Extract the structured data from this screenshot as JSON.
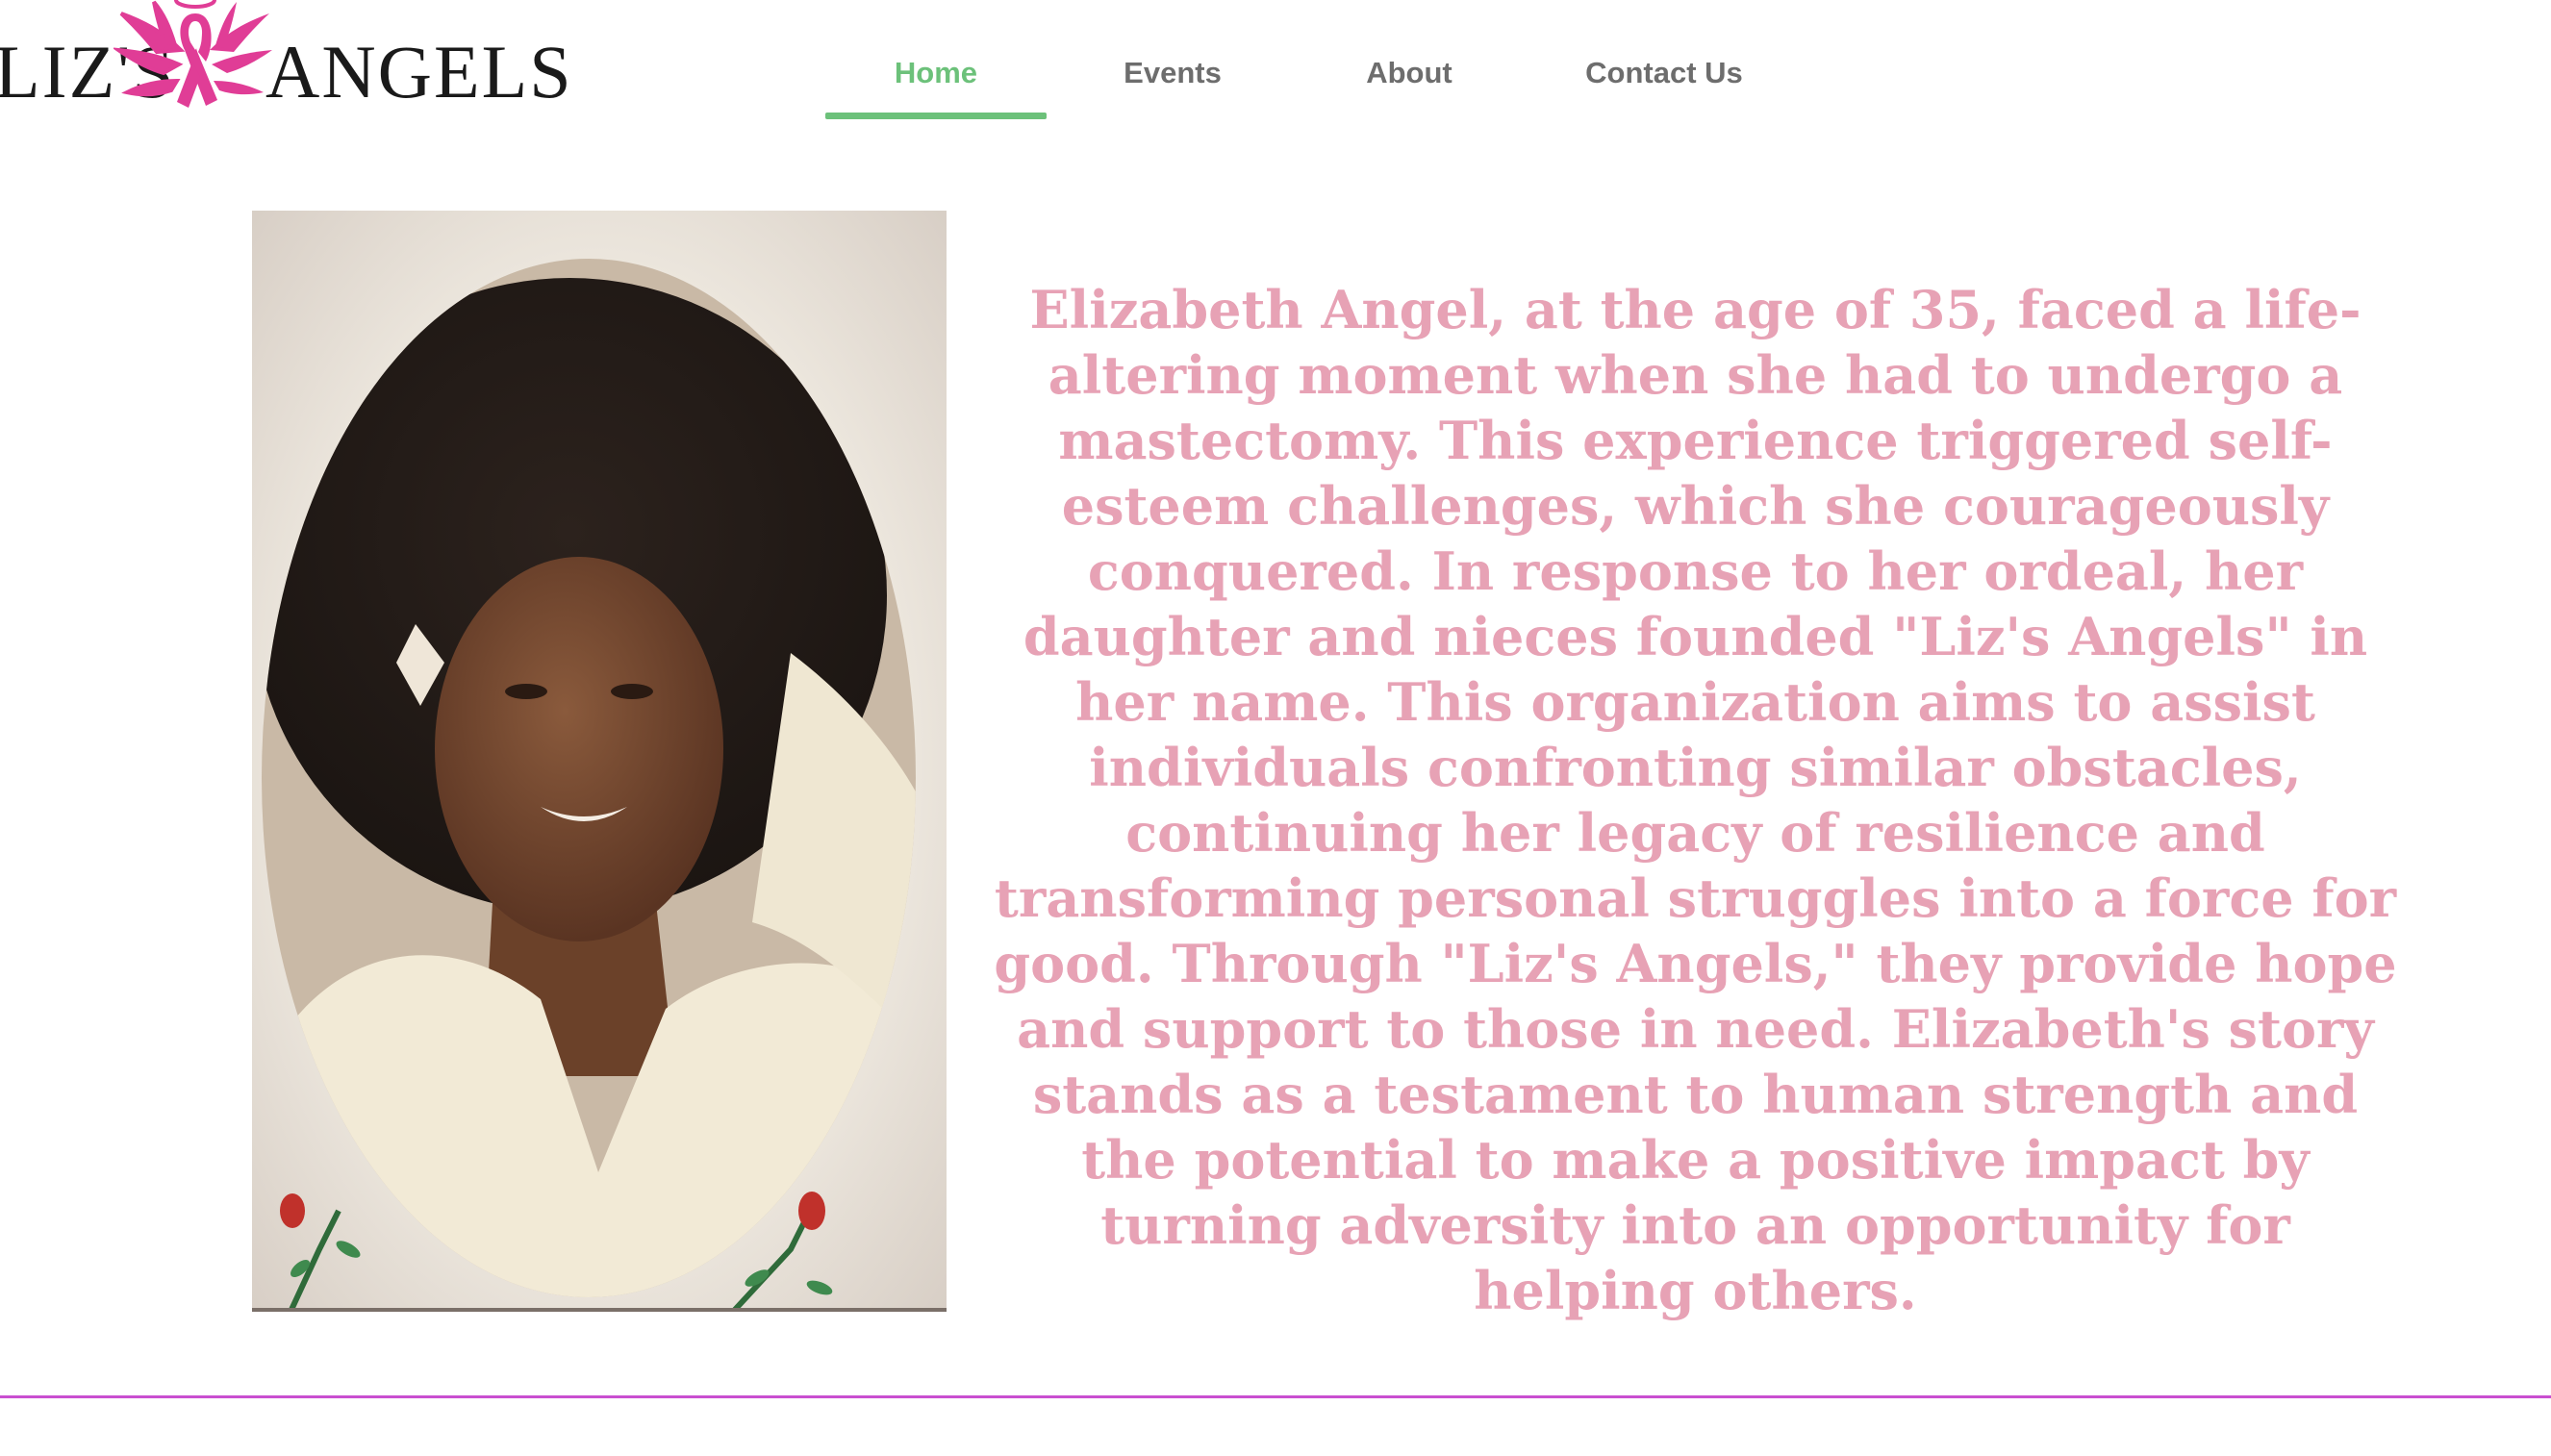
{
  "logo": {
    "left_text": "LIZ'S",
    "right_text": "ANGELS",
    "icon": "pink-ribbon-angel-wings-icon",
    "colors": {
      "ribbon": "#e03d96",
      "text": "#1a1a1a"
    }
  },
  "nav": {
    "items": [
      {
        "label": "Home",
        "active": true
      },
      {
        "label": "Events",
        "active": false
      },
      {
        "label": "About",
        "active": false
      },
      {
        "label": "Contact Us",
        "active": false
      }
    ],
    "active_color": "#6cc17a",
    "inactive_color": "#6d6d6d"
  },
  "photo": {
    "alt": "Portrait photo of Elizabeth Angel in a white top with red roses at the bottom corners"
  },
  "story": {
    "text": "Elizabeth Angel, at the age of 35, faced a life-altering moment when she had to undergo a mastectomy. This experience triggered self-esteem challenges, which she courageously conquered. In response to her ordeal, her daughter and nieces founded \"Liz's Angels\" in her name. This organization aims to assist individuals confronting similar obstacles, continuing her legacy of resilience and transforming personal struggles into a force for good. Through \"Liz's Angels,\" they provide hope and support to those in need. Elizabeth's story stands as a testament to human strength and the potential to make a positive impact by turning adversity into an opportunity for helping others.",
    "color": "#e7a2b5"
  },
  "divider_color": "#c94fd0"
}
